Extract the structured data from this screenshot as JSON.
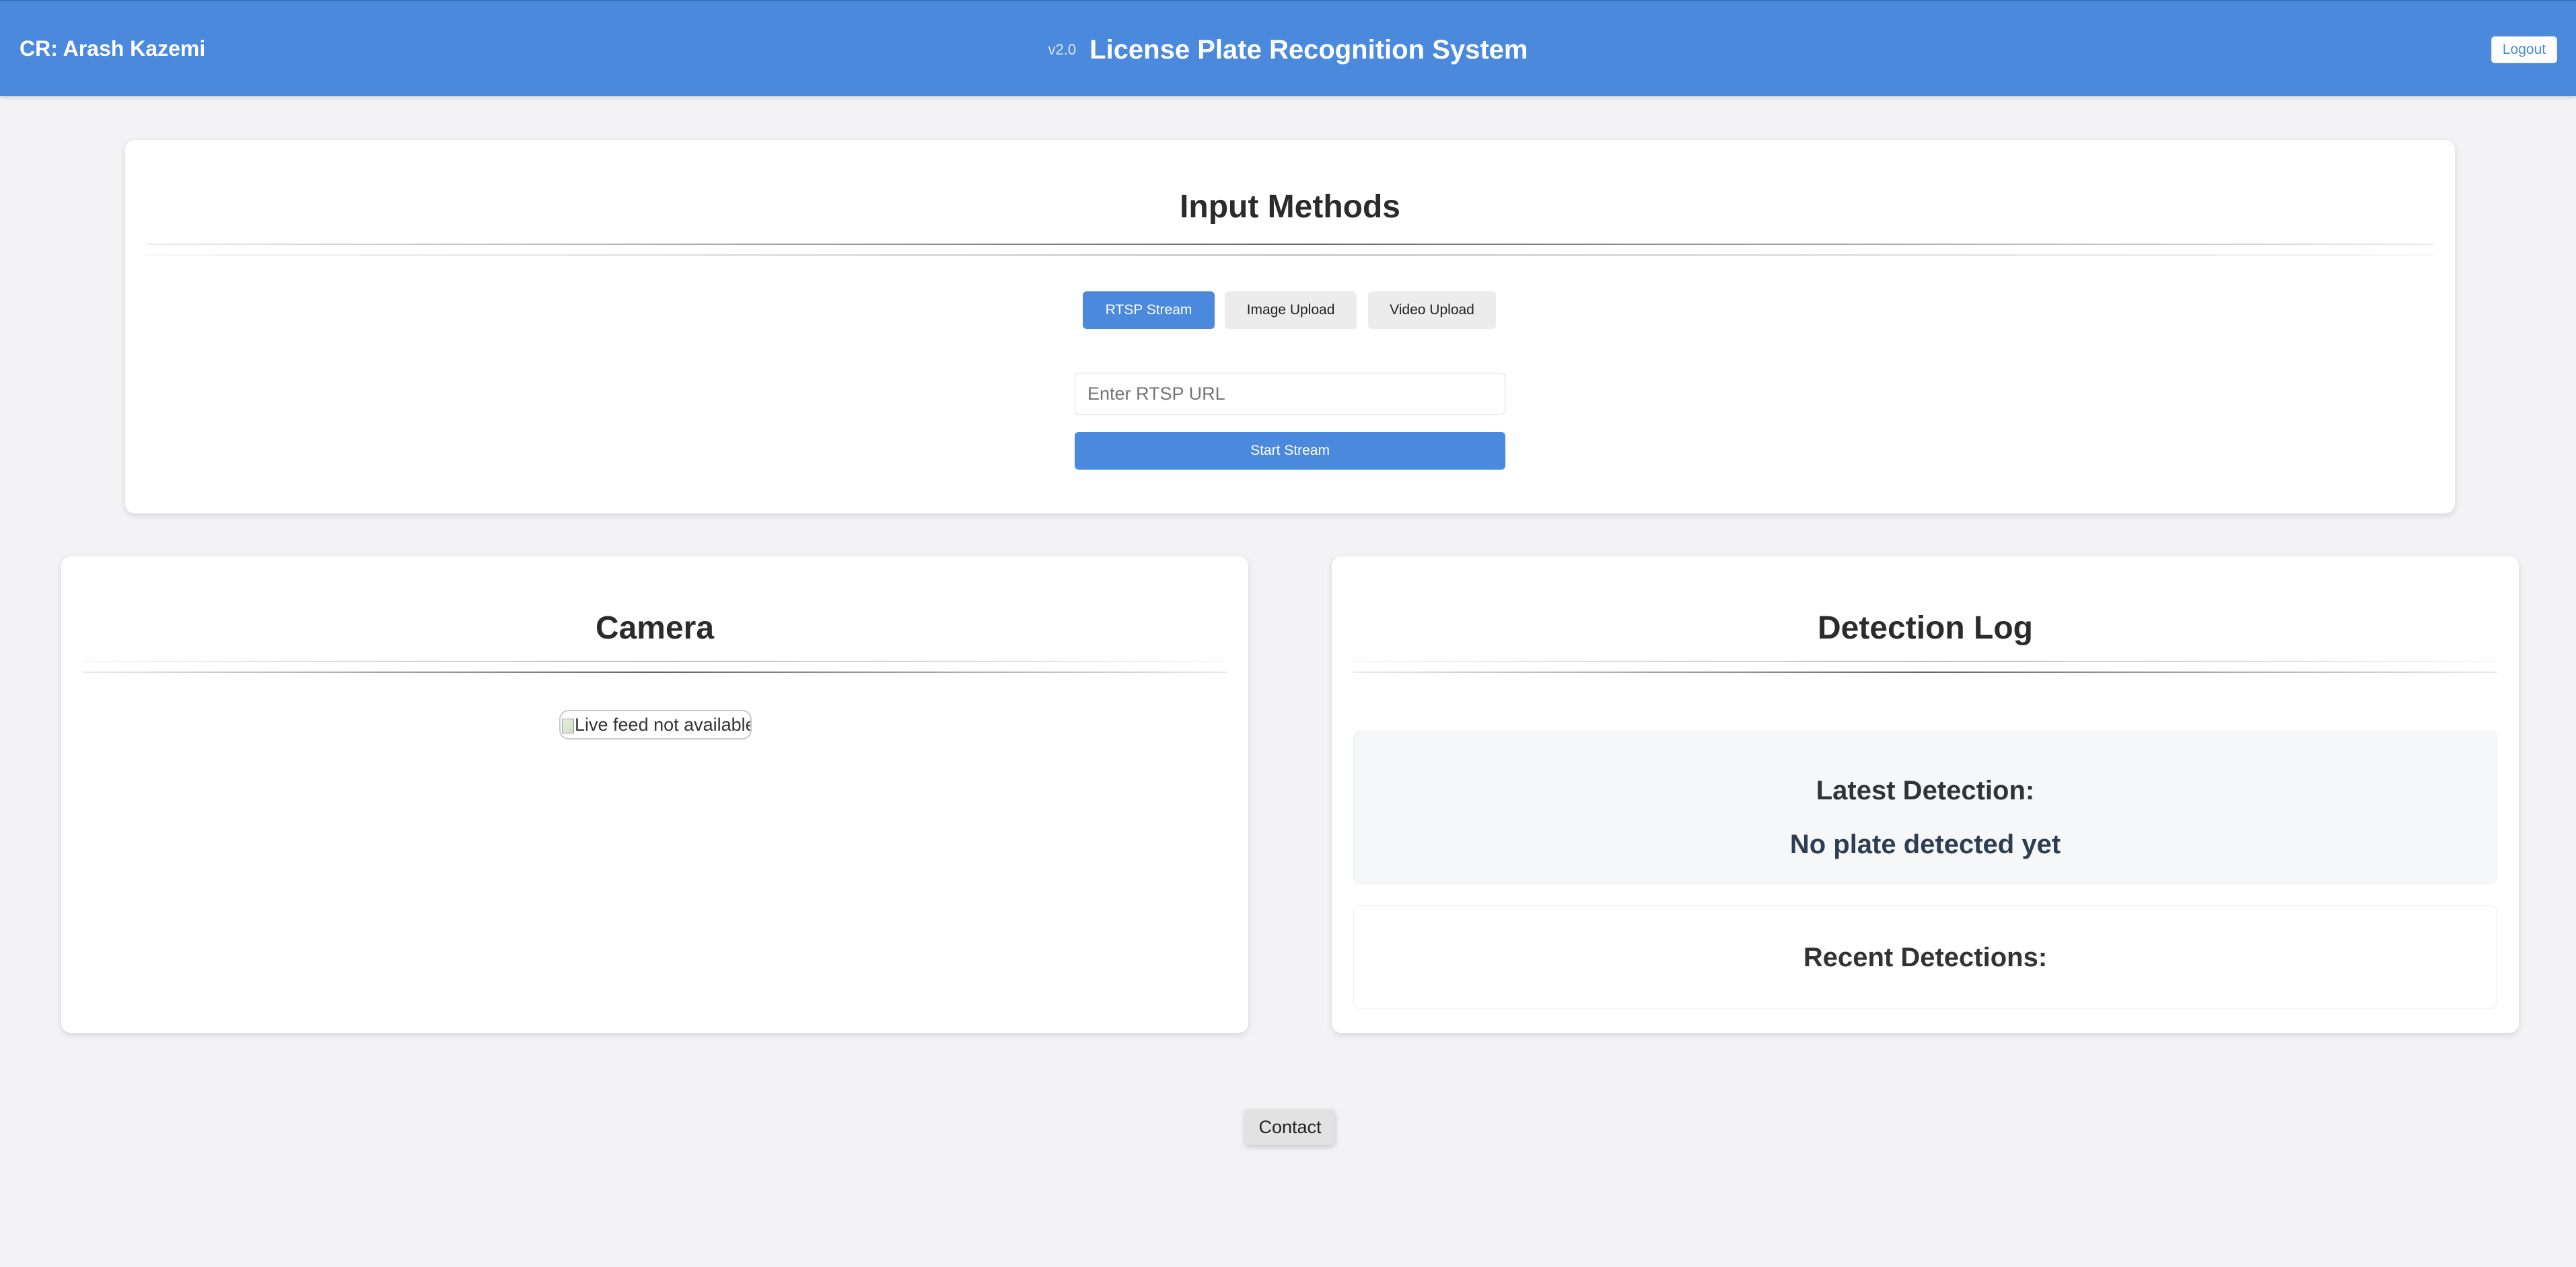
{
  "header": {
    "brand": "CR: Arash Kazemi",
    "version": "v2.0",
    "title": "License Plate Recognition System",
    "logout_label": "Logout"
  },
  "input_methods": {
    "title": "Input Methods",
    "tabs": [
      {
        "label": "RTSP Stream",
        "active": true
      },
      {
        "label": "Image Upload",
        "active": false
      },
      {
        "label": "Video Upload",
        "active": false
      }
    ],
    "url_placeholder": "Enter RTSP URL",
    "url_value": "",
    "start_label": "Start Stream"
  },
  "camera": {
    "title": "Camera",
    "feed_alt": "Live feed not available"
  },
  "detection_log": {
    "title": "Detection Log",
    "latest_label": "Latest Detection:",
    "latest_value": "No plate detected yet",
    "recent_label": "Recent Detections:"
  },
  "footer": {
    "contact_label": "Contact"
  },
  "colors": {
    "accent": "#4a89dc",
    "background": "#f3f3f6",
    "card": "#ffffff"
  }
}
